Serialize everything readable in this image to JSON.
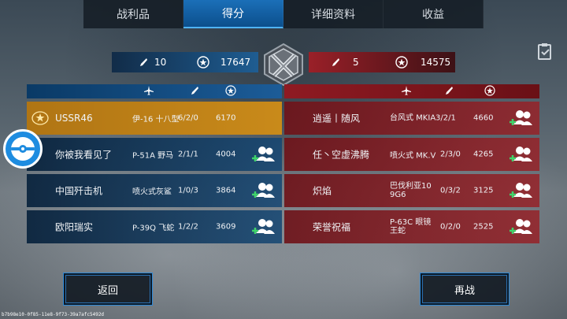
{
  "tabs": [
    {
      "label": "战利品",
      "active": false
    },
    {
      "label": "得分",
      "active": true
    },
    {
      "label": "详细资料",
      "active": false
    },
    {
      "label": "收益",
      "active": false
    }
  ],
  "scoreboard": {
    "blue": {
      "kills": "10",
      "score": "17647"
    },
    "red": {
      "kills": "5",
      "score": "14575"
    }
  },
  "blue_team": [
    {
      "name": "USSR46",
      "badge": "ussr-badge-icon",
      "plane": "伊-16 十八型",
      "kda": "6/2/0",
      "score": "6170",
      "highlight": true,
      "add_friend": false
    },
    {
      "name": "你被我看见了",
      "plane": "P-51A 野马",
      "kda": "2/1/1",
      "score": "4004",
      "add_friend": true
    },
    {
      "name": "中国歼击机",
      "plane": "喷火式灰鲨",
      "kda": "1/0/3",
      "score": "3864",
      "add_friend": true
    },
    {
      "name": "欧阳瑞实",
      "plane": "P-39Q 飞蛇",
      "kda": "1/2/2",
      "score": "3609",
      "add_friend": true
    }
  ],
  "red_team": [
    {
      "name": "逍遥丨随风",
      "plane": "台风式 MKIA",
      "kda": "3/2/1",
      "score": "4660"
    },
    {
      "name": "任丶空虚沸腾",
      "plane": "喷火式 MK.V",
      "kda": "2/3/0",
      "score": "4265"
    },
    {
      "name": "炽焰",
      "plane": "巴伐利亚10 9G6",
      "kda": "0/3/2",
      "score": "3125"
    },
    {
      "name": "荣誉祝福",
      "plane": "P-63C 眼镜 王蛇",
      "kda": "0/2/0",
      "score": "2525"
    }
  ],
  "buttons": {
    "back": "返回",
    "rematch": "再战"
  },
  "footer_id": "b7b98e10-0f85-11e8-9f73-39a7afc5492d",
  "colors": {
    "blue_team": "#1c5c98",
    "red_team": "#9a2028",
    "highlight": "#c98a1a",
    "accent": "#2f8ad8"
  }
}
